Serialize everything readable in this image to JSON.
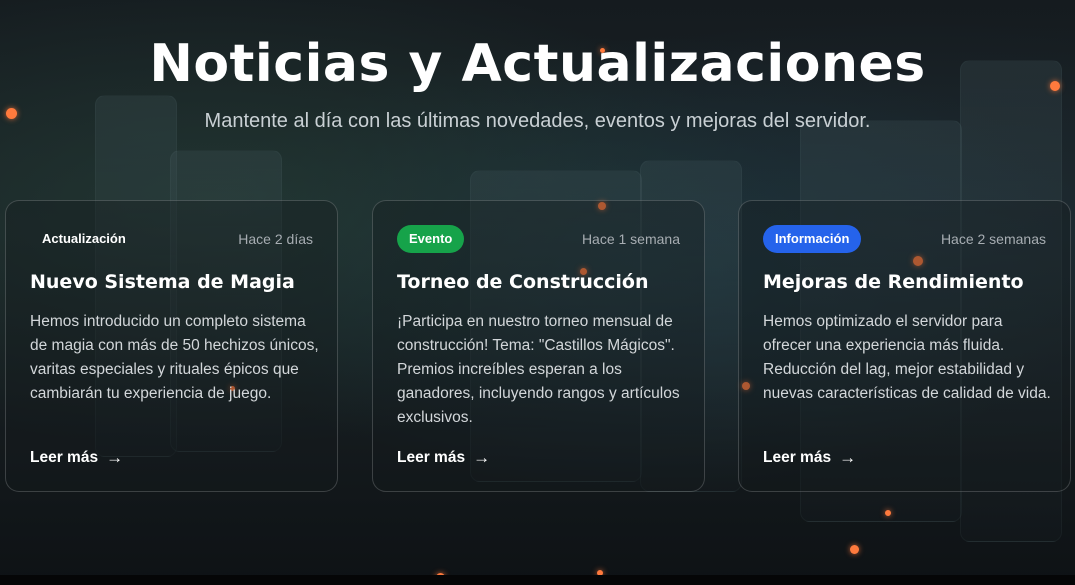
{
  "header": {
    "title": "Noticias y Actualizaciones",
    "subtitle": "Mantente al día con las últimas novedades, eventos y mejoras del servidor."
  },
  "colors": {
    "accent_particle": "#ff7a3d",
    "badge_evento": "#16a34a",
    "badge_informacion": "#2563eb"
  },
  "cards": [
    {
      "badge": "Actualización",
      "time": "Hace 2 días",
      "title": "Nuevo Sistema de Magia",
      "description": "Hemos introducido un completo sistema de magia con más de 50 hechizos únicos, varitas especiales y rituales épicos que cambiarán tu experiencia de juego.",
      "link": "Leer más",
      "link_icon": "arrow-right-icon"
    },
    {
      "badge": "Evento",
      "time": "Hace 1 semana",
      "title": "Torneo de Construcción",
      "description": "¡Participa en nuestro torneo mensual de construcción! Tema: \"Castillos Mágicos\". Premios increíbles esperan a los ganadores, incluyendo rangos y artículos exclusivos.",
      "link": "Leer más",
      "link_icon": "arrow-right-icon"
    },
    {
      "badge": "Información",
      "time": "Hace 2 semanas",
      "title": "Mejoras de Rendimiento",
      "description": "Hemos optimizado el servidor para ofrecer una experiencia más fluida. Reducción del lag, mejor estabilidad y nuevas características de calidad de vida.",
      "link": "Leer más",
      "link_icon": "arrow-right-icon"
    }
  ]
}
